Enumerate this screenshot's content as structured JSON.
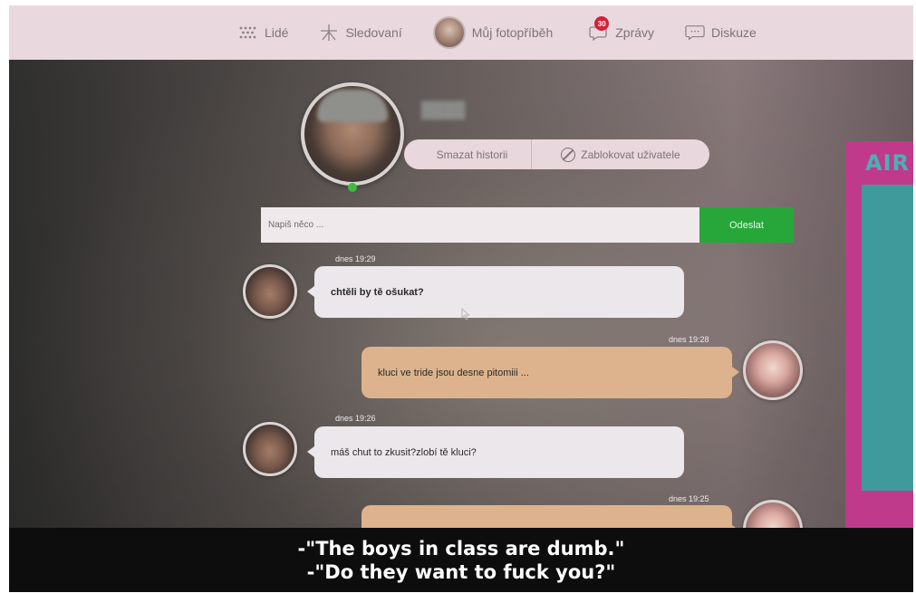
{
  "nav": {
    "items": [
      {
        "label": "Lidé",
        "icon": "people-dots-icon"
      },
      {
        "label": "Sledovaní",
        "icon": "star-icon"
      },
      {
        "label": "Můj fotopříběh",
        "icon": "avatar"
      },
      {
        "label": "Zprávy",
        "icon": "chat-bubble-icon",
        "badge": "30"
      },
      {
        "label": "Diskuze",
        "icon": "speech-bubble-icon"
      }
    ]
  },
  "profile": {
    "actions": {
      "delete_history": "Smazat historii",
      "block_user": "Zablokovat uživatele"
    }
  },
  "composer": {
    "placeholder": "Napiš něco ...",
    "send_label": "Odeslat"
  },
  "messages": [
    {
      "from": "them",
      "time": "dnes 19:29",
      "text": "chtěli by tě ošukat?"
    },
    {
      "from": "me",
      "time": "dnes 19:28",
      "text": "kluci ve tride jsou desne pitomiii ..."
    },
    {
      "from": "them",
      "time": "dnes 19:26",
      "text": "máš chut to zkusit?zlobí tě kluci?"
    },
    {
      "from": "me",
      "time": "dnes 19:25",
      "text": ""
    }
  ],
  "ad": {
    "title": "AIR"
  },
  "subtitles": {
    "line1": "-\"The boys in class are dumb.\"",
    "line2": "-\"Do they want to fuck you?\""
  },
  "colors": {
    "nav_bg": "#e9d9de",
    "send_button": "#27a73a",
    "bubble_them": "#ebe7eb",
    "bubble_me": "#ddb38d",
    "badge": "#d2213a",
    "online": "#3dbb3d"
  }
}
